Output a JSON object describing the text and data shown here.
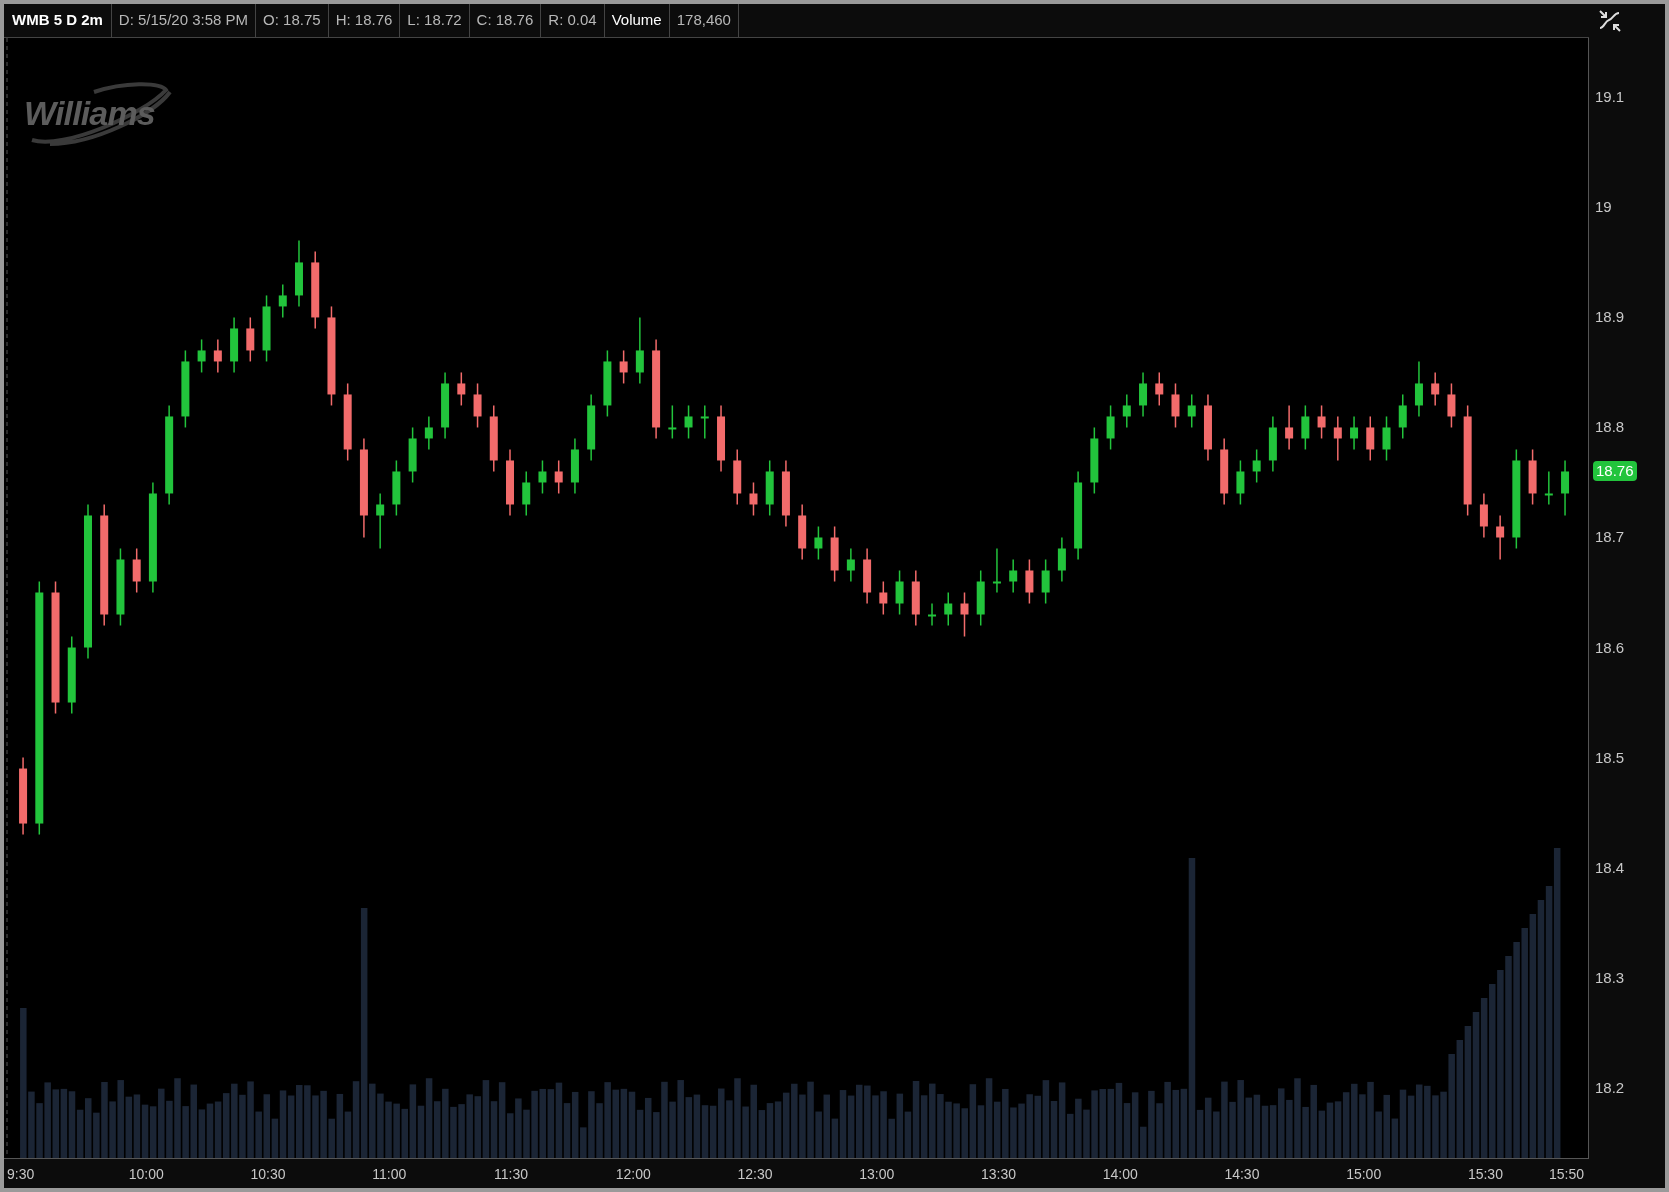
{
  "header": {
    "symbol": "WMB 5 D 2m",
    "fields": [
      {
        "kind": "plain",
        "text": "D: 5/15/20 3:58 PM"
      },
      {
        "kind": "plain",
        "text": "O: 18.75"
      },
      {
        "kind": "plain",
        "text": "H: 18.76"
      },
      {
        "kind": "plain",
        "text": "L: 18.72"
      },
      {
        "kind": "plain",
        "text": "C: 18.76"
      },
      {
        "kind": "plain",
        "text": "R: 0.04"
      },
      {
        "kind": "emphasis",
        "text": "Volume"
      },
      {
        "kind": "plain",
        "text": "178,460"
      }
    ]
  },
  "logo": {
    "text": "Williams"
  },
  "price_badge": {
    "text": "18.76"
  },
  "chart_data": {
    "type": "candlestick",
    "xlim": [
      9.4217,
      15.9317
    ],
    "ylim": [
      18.136,
      19.154
    ],
    "x": [
      9.5,
      9.5667,
      9.6333,
      9.7,
      9.7667,
      9.8333,
      9.9,
      9.9667,
      10.0333,
      10.1,
      10.1667,
      10.2333,
      10.3,
      10.3667,
      10.4333,
      10.5,
      10.5667,
      10.6333,
      10.7,
      10.7667,
      10.8333,
      10.9,
      10.9667,
      11.0333,
      11.1,
      11.1667,
      11.2333,
      11.3,
      11.3667,
      11.4333,
      11.5,
      11.5667,
      11.6333,
      11.7,
      11.7667,
      11.8333,
      11.9,
      11.9667,
      12.0333,
      12.1,
      12.1667,
      12.2333,
      12.3,
      12.3667,
      12.4333,
      12.5,
      12.5667,
      12.6333,
      12.7,
      12.7667,
      12.8333,
      12.9,
      12.9667,
      13.0333,
      13.1,
      13.1667,
      13.2333,
      13.3,
      13.3667,
      13.4333,
      13.5,
      13.5667,
      13.6333,
      13.7,
      13.7667,
      13.8333,
      13.9,
      13.9667,
      14.0333,
      14.1,
      14.1667,
      14.2333,
      14.3,
      14.3667,
      14.4333,
      14.5,
      14.5667,
      14.6333,
      14.7,
      14.7667,
      14.8333,
      14.9,
      14.9667,
      15.0333,
      15.1,
      15.1667,
      15.2333,
      15.3,
      15.3667,
      15.4333,
      15.5,
      15.5667,
      15.6333,
      15.7,
      15.7667,
      15.8333
    ],
    "ohlc": [
      [
        18.49,
        18.5,
        18.43,
        18.44
      ],
      [
        18.44,
        18.66,
        18.43,
        18.65
      ],
      [
        18.65,
        18.66,
        18.54,
        18.55
      ],
      [
        18.55,
        18.61,
        18.54,
        18.6
      ],
      [
        18.6,
        18.73,
        18.59,
        18.72
      ],
      [
        18.72,
        18.73,
        18.62,
        18.63
      ],
      [
        18.63,
        18.69,
        18.62,
        18.68
      ],
      [
        18.68,
        18.69,
        18.65,
        18.66
      ],
      [
        18.66,
        18.75,
        18.65,
        18.74
      ],
      [
        18.74,
        18.82,
        18.73,
        18.81
      ],
      [
        18.81,
        18.87,
        18.8,
        18.86
      ],
      [
        18.86,
        18.88,
        18.85,
        18.87
      ],
      [
        18.87,
        18.88,
        18.85,
        18.86
      ],
      [
        18.86,
        18.9,
        18.85,
        18.89
      ],
      [
        18.89,
        18.9,
        18.86,
        18.87
      ],
      [
        18.87,
        18.92,
        18.86,
        18.91
      ],
      [
        18.91,
        18.93,
        18.9,
        18.92
      ],
      [
        18.92,
        18.97,
        18.91,
        18.95
      ],
      [
        18.95,
        18.96,
        18.89,
        18.9
      ],
      [
        18.9,
        18.91,
        18.82,
        18.83
      ],
      [
        18.83,
        18.84,
        18.77,
        18.78
      ],
      [
        18.78,
        18.79,
        18.7,
        18.72
      ],
      [
        18.72,
        18.74,
        18.69,
        18.73
      ],
      [
        18.73,
        18.77,
        18.72,
        18.76
      ],
      [
        18.76,
        18.8,
        18.75,
        18.79
      ],
      [
        18.79,
        18.81,
        18.78,
        18.8
      ],
      [
        18.8,
        18.85,
        18.79,
        18.84
      ],
      [
        18.84,
        18.85,
        18.82,
        18.83
      ],
      [
        18.83,
        18.84,
        18.8,
        18.81
      ],
      [
        18.81,
        18.82,
        18.76,
        18.77
      ],
      [
        18.77,
        18.78,
        18.72,
        18.73
      ],
      [
        18.73,
        18.76,
        18.72,
        18.75
      ],
      [
        18.75,
        18.77,
        18.74,
        18.76
      ],
      [
        18.76,
        18.77,
        18.74,
        18.75
      ],
      [
        18.75,
        18.79,
        18.74,
        18.78
      ],
      [
        18.78,
        18.83,
        18.77,
        18.82
      ],
      [
        18.82,
        18.87,
        18.81,
        18.86
      ],
      [
        18.86,
        18.87,
        18.84,
        18.85
      ],
      [
        18.85,
        18.9,
        18.84,
        18.87
      ],
      [
        18.87,
        18.88,
        18.79,
        18.8
      ],
      [
        18.8,
        18.82,
        18.79,
        18.8
      ],
      [
        18.8,
        18.82,
        18.79,
        18.81
      ],
      [
        18.81,
        18.82,
        18.79,
        18.81
      ],
      [
        18.81,
        18.82,
        18.76,
        18.77
      ],
      [
        18.77,
        18.78,
        18.73,
        18.74
      ],
      [
        18.74,
        18.75,
        18.72,
        18.73
      ],
      [
        18.73,
        18.77,
        18.72,
        18.76
      ],
      [
        18.76,
        18.77,
        18.71,
        18.72
      ],
      [
        18.72,
        18.73,
        18.68,
        18.69
      ],
      [
        18.69,
        18.71,
        18.68,
        18.7
      ],
      [
        18.7,
        18.71,
        18.66,
        18.67
      ],
      [
        18.67,
        18.69,
        18.66,
        18.68
      ],
      [
        18.68,
        18.69,
        18.64,
        18.65
      ],
      [
        18.65,
        18.66,
        18.63,
        18.64
      ],
      [
        18.64,
        18.67,
        18.63,
        18.66
      ],
      [
        18.66,
        18.67,
        18.62,
        18.63
      ],
      [
        18.63,
        18.64,
        18.62,
        18.63
      ],
      [
        18.63,
        18.65,
        18.62,
        18.64
      ],
      [
        18.64,
        18.65,
        18.61,
        18.63
      ],
      [
        18.63,
        18.67,
        18.62,
        18.66
      ],
      [
        18.66,
        18.69,
        18.65,
        18.66
      ],
      [
        18.66,
        18.68,
        18.65,
        18.67
      ],
      [
        18.67,
        18.68,
        18.64,
        18.65
      ],
      [
        18.65,
        18.68,
        18.64,
        18.67
      ],
      [
        18.67,
        18.7,
        18.66,
        18.69
      ],
      [
        18.69,
        18.76,
        18.68,
        18.75
      ],
      [
        18.75,
        18.8,
        18.74,
        18.79
      ],
      [
        18.79,
        18.82,
        18.78,
        18.81
      ],
      [
        18.81,
        18.83,
        18.8,
        18.82
      ],
      [
        18.82,
        18.85,
        18.81,
        18.84
      ],
      [
        18.84,
        18.85,
        18.82,
        18.83
      ],
      [
        18.83,
        18.84,
        18.8,
        18.81
      ],
      [
        18.81,
        18.83,
        18.8,
        18.82
      ],
      [
        18.82,
        18.83,
        18.77,
        18.78
      ],
      [
        18.78,
        18.79,
        18.73,
        18.74
      ],
      [
        18.74,
        18.77,
        18.73,
        18.76
      ],
      [
        18.76,
        18.78,
        18.75,
        18.77
      ],
      [
        18.77,
        18.81,
        18.76,
        18.8
      ],
      [
        18.8,
        18.82,
        18.78,
        18.79
      ],
      [
        18.79,
        18.82,
        18.78,
        18.81
      ],
      [
        18.81,
        18.82,
        18.79,
        18.8
      ],
      [
        18.8,
        18.81,
        18.77,
        18.79
      ],
      [
        18.79,
        18.81,
        18.78,
        18.8
      ],
      [
        18.8,
        18.81,
        18.77,
        18.78
      ],
      [
        18.78,
        18.81,
        18.77,
        18.8
      ],
      [
        18.8,
        18.83,
        18.79,
        18.82
      ],
      [
        18.82,
        18.86,
        18.81,
        18.84
      ],
      [
        18.84,
        18.85,
        18.82,
        18.83
      ],
      [
        18.83,
        18.84,
        18.8,
        18.81
      ],
      [
        18.81,
        18.82,
        18.72,
        18.73
      ],
      [
        18.73,
        18.74,
        18.7,
        18.71
      ],
      [
        18.71,
        18.72,
        18.68,
        18.7
      ],
      [
        18.7,
        18.78,
        18.69,
        18.77
      ],
      [
        18.77,
        18.78,
        18.73,
        18.74
      ],
      [
        18.74,
        18.76,
        18.73,
        18.74
      ],
      [
        18.74,
        18.77,
        18.72,
        18.76
      ]
    ],
    "yticks": [
      {
        "value": 18.2,
        "label": "18.2"
      },
      {
        "value": 18.3,
        "label": "18.3"
      },
      {
        "value": 18.4,
        "label": "18.4"
      },
      {
        "value": 18.5,
        "label": "18.5"
      },
      {
        "value": 18.6,
        "label": "18.6"
      },
      {
        "value": 18.7,
        "label": "18.7"
      },
      {
        "value": 18.8,
        "label": "18.8"
      },
      {
        "value": 18.9,
        "label": "18.9"
      },
      {
        "value": 19,
        "label": "19"
      },
      {
        "value": 19.1,
        "label": "19.1"
      }
    ],
    "xticks": [
      {
        "value": 9.5,
        "label": "9:30"
      },
      {
        "value": 10,
        "label": "10:00"
      },
      {
        "value": 10.5,
        "label": "10:30"
      },
      {
        "value": 11,
        "label": "11:00"
      },
      {
        "value": 11.5,
        "label": "11:30"
      },
      {
        "value": 12,
        "label": "12:00"
      },
      {
        "value": 12.5,
        "label": "12:30"
      },
      {
        "value": 13,
        "label": "13:00"
      },
      {
        "value": 13.5,
        "label": "13:30"
      },
      {
        "value": 14,
        "label": "14:00"
      },
      {
        "value": 14.5,
        "label": "14:30"
      },
      {
        "value": 15,
        "label": "15:00"
      },
      {
        "value": 15.5,
        "label": "15:30"
      },
      {
        "value": 15.8333,
        "label": "15:50"
      }
    ]
  }
}
